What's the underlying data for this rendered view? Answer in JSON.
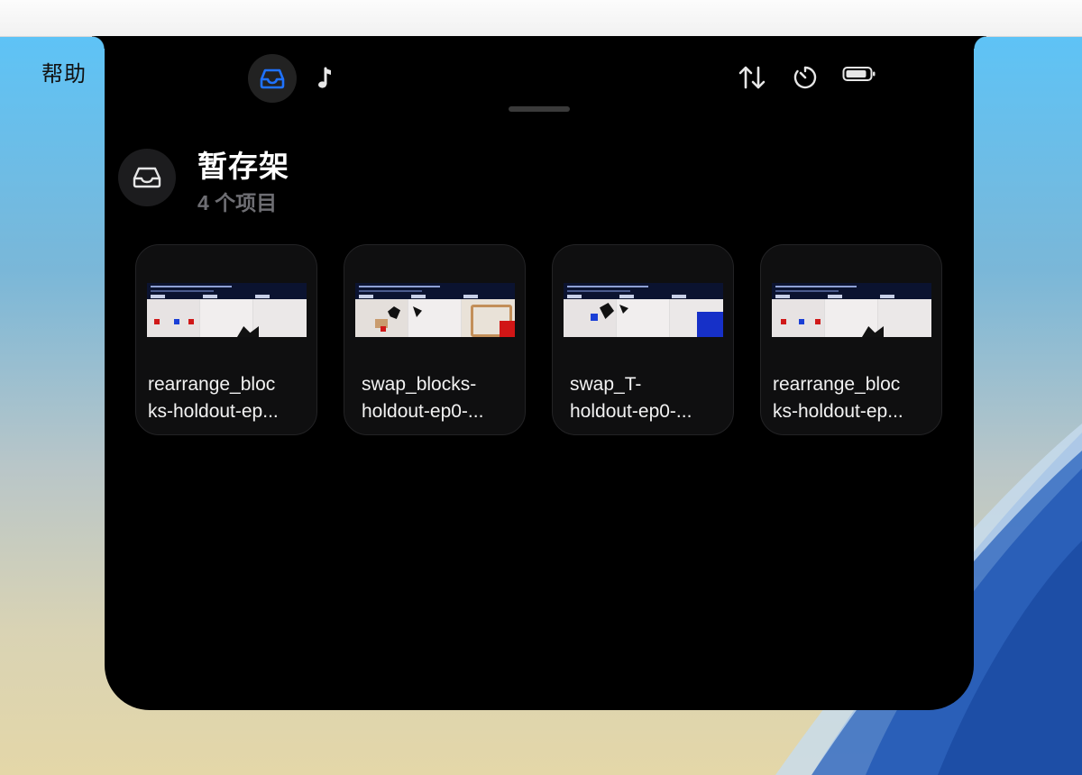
{
  "menubar": {
    "help_label": "帮助"
  },
  "toolbar": {
    "tabs": [
      {
        "icon": "tray-icon",
        "active": true,
        "accent": "#1f72ff"
      },
      {
        "icon": "music-note-icon",
        "active": false
      }
    ],
    "status_icons": [
      "sort-arrows-icon",
      "timer-icon",
      "battery-icon"
    ]
  },
  "shelf": {
    "icon": "tray-icon",
    "title": "暂存架",
    "subtitle": "4 个项目",
    "items": [
      {
        "name_line1": "rearrange_bloc",
        "name_line2": "ks-holdout-ep..."
      },
      {
        "name_line1": "swap_blocks-",
        "name_line2": "holdout-ep0-..."
      },
      {
        "name_line1": "swap_T-",
        "name_line2": "holdout-ep0-..."
      },
      {
        "name_line1": "rearrange_bloc",
        "name_line2": "ks-holdout-ep..."
      }
    ]
  },
  "colors": {
    "panel_bg": "#000000",
    "accent": "#1f72ff",
    "subtitle": "#6e6e73"
  }
}
